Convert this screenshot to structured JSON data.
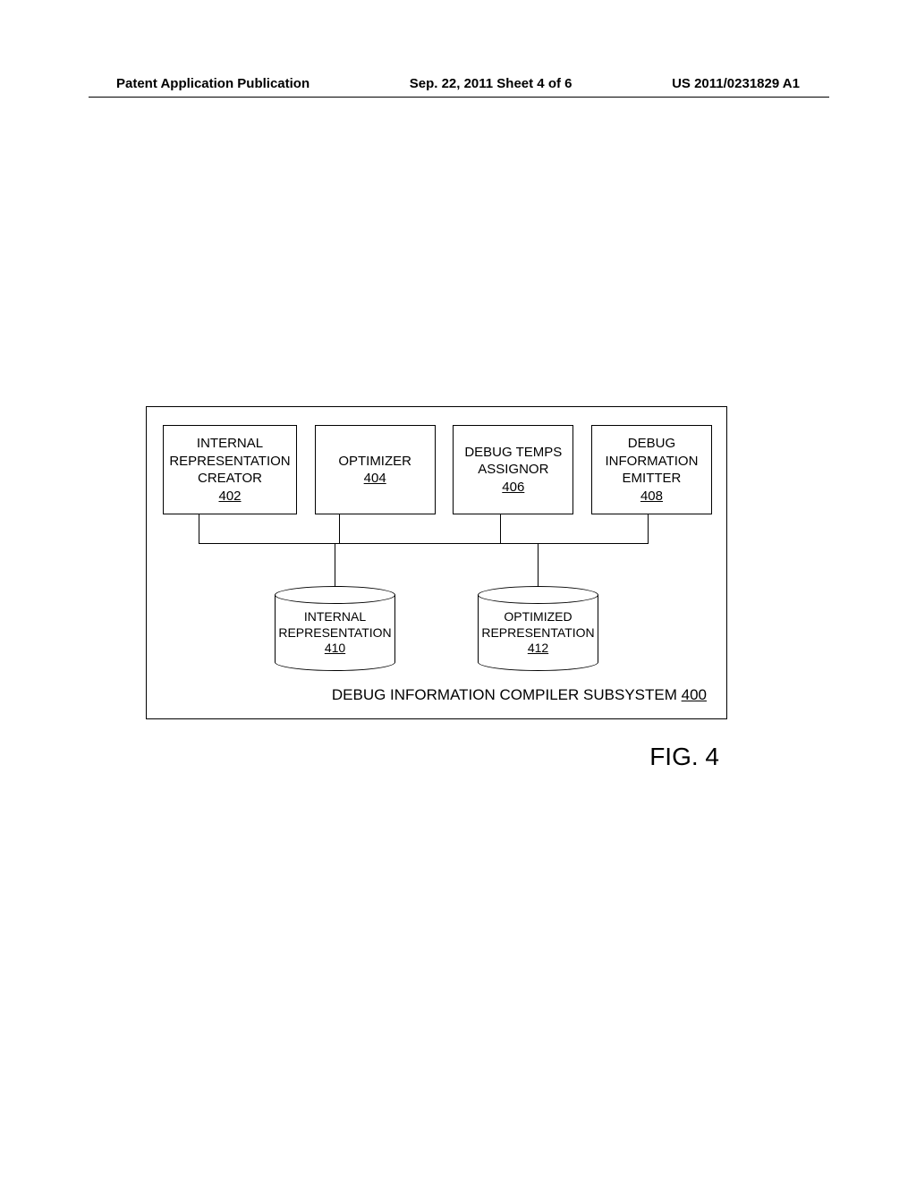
{
  "header": {
    "publication": "Patent Application Publication",
    "date_sheet": "Sep. 22, 2011  Sheet 4 of 6",
    "pub_number": "US 2011/0231829 A1"
  },
  "diagram": {
    "boxes": {
      "creator": {
        "line1": "INTERNAL",
        "line2": "REPRESENTATION",
        "line3": "CREATOR",
        "ref": "402"
      },
      "optimizer": {
        "line1": "OPTIMIZER",
        "ref": "404"
      },
      "assignor": {
        "line1": "DEBUG TEMPS",
        "line2": "ASSIGNOR",
        "ref": "406"
      },
      "emitter": {
        "line1": "DEBUG",
        "line2": "INFORMATION",
        "line3": "EMITTER",
        "ref": "408"
      }
    },
    "cylinders": {
      "internal": {
        "line1": "INTERNAL",
        "line2": "REPRESENTATION",
        "ref": "410"
      },
      "optimized": {
        "line1": "OPTIMIZED",
        "line2": "REPRESENTATION",
        "ref": "412"
      }
    },
    "system_caption": {
      "text": "DEBUG INFORMATION COMPILER SUBSYSTEM",
      "ref": "400"
    }
  },
  "figure_label": "FIG. 4"
}
